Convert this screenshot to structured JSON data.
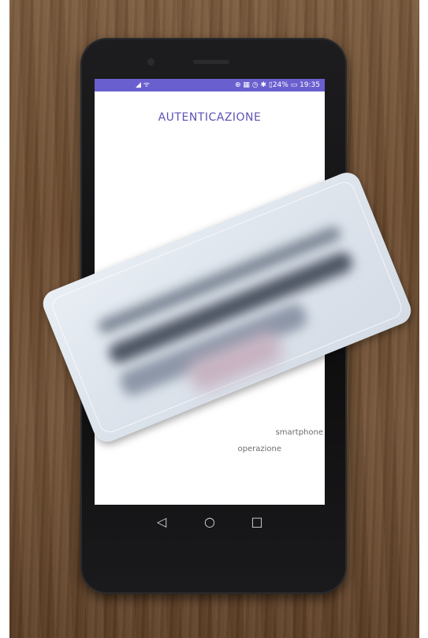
{
  "status_bar": {
    "left_icons": "◢ ᯤ",
    "right_text": "⊕ ▦ ◷ ✱ ▯24% ▭ 19:35"
  },
  "screen": {
    "title": "AUTENTICAZIONE",
    "instruction_line1": "smartphone",
    "instruction_line2": "operazione"
  },
  "navigation": {
    "back_icon": "◁",
    "home_icon": "○",
    "recent_icon": "□"
  },
  "colors": {
    "status_bar": "#6a5fcf",
    "title": "#5b54b6"
  }
}
